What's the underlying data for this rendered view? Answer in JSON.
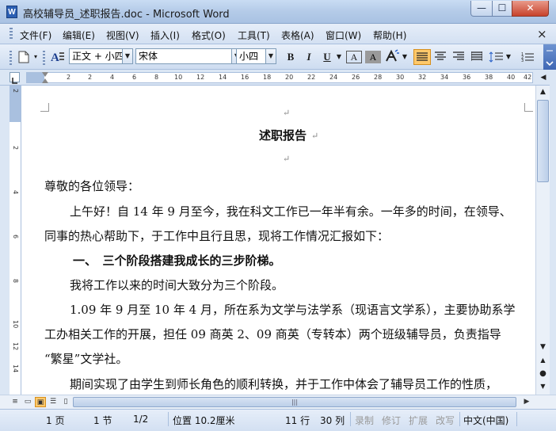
{
  "window": {
    "title": "高校辅导员_述职报告.doc - Microsoft Word",
    "app_icon_letter": "W",
    "min_label": "—",
    "max_label": "☐",
    "close_label": "✕"
  },
  "menu": {
    "items": [
      "文件(F)",
      "编辑(E)",
      "视图(V)",
      "插入(I)",
      "格式(O)",
      "工具(T)",
      "表格(A)",
      "窗口(W)",
      "帮助(H)"
    ],
    "close_doc": "×"
  },
  "toolbar": {
    "style_value": "正文 + 小四",
    "font_value": "宋体",
    "size_value": "小四",
    "bold": "B",
    "italic": "I",
    "underline": "U",
    "font_color": "A",
    "char_shading": "A"
  },
  "ruler": {
    "h_ticks": [
      "2",
      "2",
      "4",
      "6",
      "8",
      "10",
      "12",
      "14",
      "16",
      "18",
      "20",
      "22",
      "24",
      "26",
      "28",
      "30",
      "32",
      "34",
      "36",
      "38",
      "40",
      "42"
    ],
    "v_ticks": [
      "2",
      "2",
      "4",
      "6",
      "8",
      "10",
      "12",
      "14"
    ]
  },
  "document": {
    "mark": "↵",
    "title": "述职报告",
    "lines": [
      "尊敬的各位领导：",
      "上午好！自 14 年 9 月至今，我在科文工作已一年半有余。一年多的时间，在领导、",
      "同事的热心帮助下，于工作中且行且思，现将工作情况汇报如下：",
      "一、　三个阶段搭建我成长的三步阶梯。",
      "我将工作以来的时间大致分为三个阶段。",
      "1.09 年 9 月至 10 年 4 月，所在系为文学与法学系（现语言文学系），主要协助系学",
      "工办相关工作的开展，担任 09 商英 2、09 商英（专转本）两个班级辅导员，负责指导",
      "“繁星”文学社。",
      "期间实现了由学生到师长角色的顺利转换，并于工作中体会了辅导员工作的性质，"
    ]
  },
  "statusbar": {
    "page": "1 页",
    "section": "1 节",
    "page_of": "1/2",
    "position": "位置 10.2厘米",
    "line": "11 行",
    "column": "30 列",
    "rec": "录制",
    "trk": "修订",
    "ext": "扩展",
    "ovr": "改写",
    "language": "中文(中国)"
  }
}
